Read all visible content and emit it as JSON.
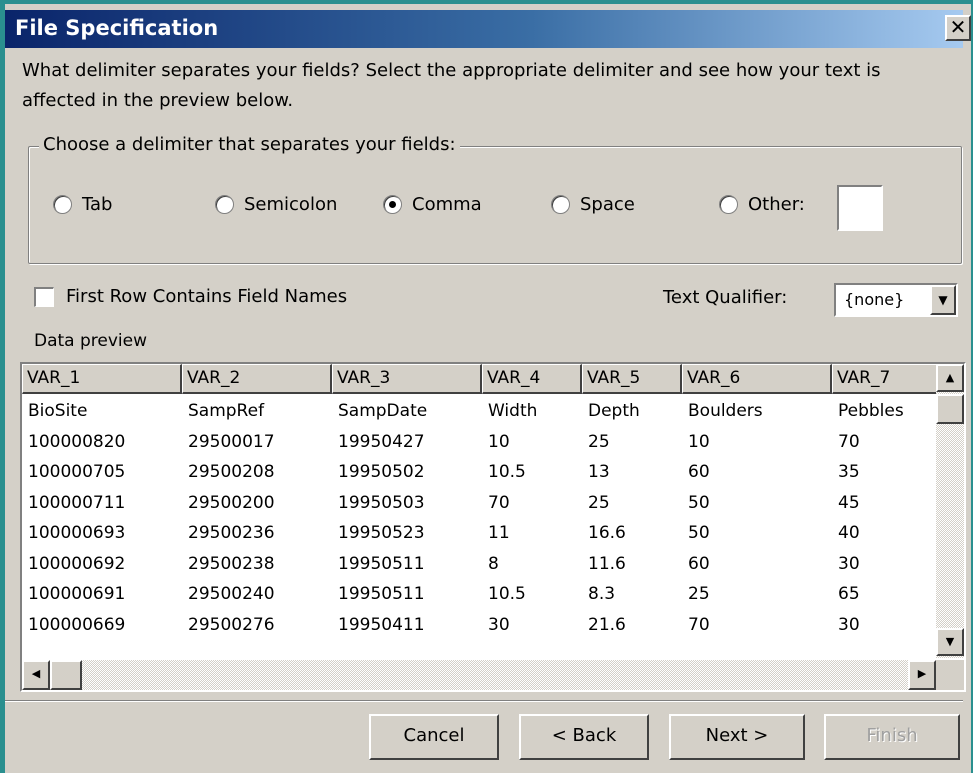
{
  "window": {
    "title": "File Specification",
    "close_glyph": "✕"
  },
  "instructions": "What delimiter separates your fields? Select the appropriate delimiter and see how your text is\naffected in the preview below.",
  "delimiter_group": {
    "legend": "Choose a delimiter that separates your fields:",
    "options": [
      {
        "label": "Tab",
        "selected": false
      },
      {
        "label": "Semicolon",
        "selected": false
      },
      {
        "label": "Comma",
        "selected": true
      },
      {
        "label": "Space",
        "selected": false
      },
      {
        "label": "Other:",
        "selected": false
      }
    ],
    "other_value": ""
  },
  "first_row_field_names": {
    "label": "First Row Contains Field Names",
    "checked": false
  },
  "text_qualifier": {
    "label": "Text Qualifier:",
    "value": "{none}"
  },
  "preview": {
    "legend": "Data preview",
    "columns": [
      "VAR_1",
      "VAR_2",
      "VAR_3",
      "VAR_4",
      "VAR_5",
      "VAR_6",
      "VAR_7"
    ],
    "rows": [
      [
        "BioSite",
        "SampRef",
        "SampDate",
        "Width",
        "Depth",
        "Boulders",
        "Pebbles"
      ],
      [
        "100000820",
        "29500017",
        "19950427",
        "10",
        "25",
        "10",
        "70"
      ],
      [
        "100000705",
        "29500208",
        "19950502",
        "10.5",
        "13",
        "60",
        "35"
      ],
      [
        "100000711",
        "29500200",
        "19950503",
        "70",
        "25",
        "50",
        "45"
      ],
      [
        "100000693",
        "29500236",
        "19950523",
        "11",
        "16.6",
        "50",
        "40"
      ],
      [
        "100000692",
        "29500238",
        "19950511",
        "8",
        "11.6",
        "60",
        "30"
      ],
      [
        "100000691",
        "29500240",
        "19950511",
        "10.5",
        "8.3",
        "25",
        "65"
      ],
      [
        "100000669",
        "29500276",
        "19950411",
        "30",
        "21.6",
        "70",
        "30"
      ]
    ]
  },
  "buttons": {
    "cancel": "Cancel",
    "back": "< Back",
    "next": "Next >",
    "finish": "Finish"
  }
}
